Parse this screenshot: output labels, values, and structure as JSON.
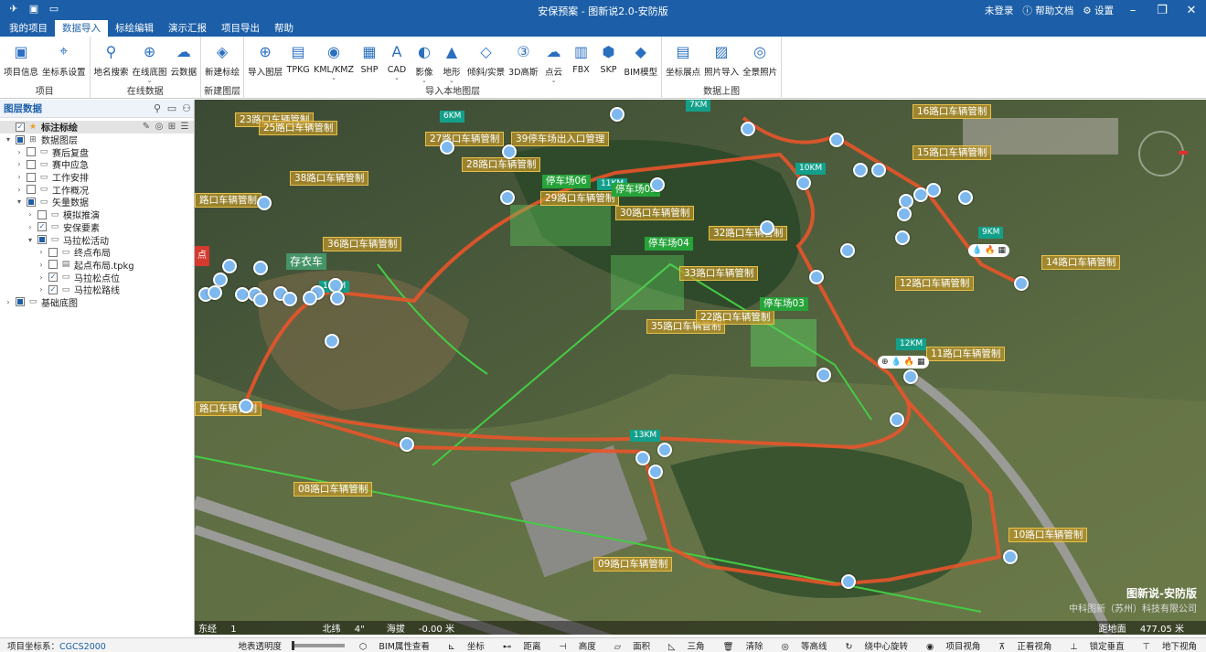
{
  "titlebar": {
    "title": "安保预案 - 图新说2.0-安防版",
    "login": "未登录",
    "help": "帮助文档",
    "settings": "设置"
  },
  "menu": {
    "items": [
      "我的项目",
      "数据导入",
      "标绘编辑",
      "演示汇报",
      "项目导出",
      "帮助"
    ],
    "active": 1
  },
  "ribbon": {
    "groups": [
      {
        "label": "项目",
        "buttons": [
          {
            "label": "项目信息",
            "icon": "project-info-icon",
            "glyph": "▣"
          },
          {
            "label": "坐标系设置",
            "icon": "coordinate-icon",
            "glyph": "⌖"
          }
        ]
      },
      {
        "label": "在线数据",
        "buttons": [
          {
            "label": "地名搜索",
            "icon": "place-search-icon",
            "glyph": "⚲"
          },
          {
            "label": "在线底图",
            "icon": "globe-icon",
            "glyph": "⊕",
            "dd": true
          },
          {
            "label": "云数据",
            "icon": "cloud-icon",
            "glyph": "☁"
          }
        ]
      },
      {
        "label": "新建图层",
        "buttons": [
          {
            "label": "新建标绘",
            "icon": "layers-icon",
            "glyph": "◈"
          }
        ]
      },
      {
        "label": "导入本地图层",
        "buttons": [
          {
            "label": "导入图层",
            "icon": "import-layer-icon",
            "glyph": "⊕"
          },
          {
            "label": "TPKG",
            "icon": "tpkg-icon",
            "glyph": "▤"
          },
          {
            "label": "KML/KMZ",
            "icon": "kml-icon",
            "glyph": "◉",
            "dd": true
          },
          {
            "label": "SHP",
            "icon": "shp-icon",
            "glyph": "▦"
          },
          {
            "label": "CAD",
            "icon": "cad-icon",
            "glyph": "A",
            "dd": true
          },
          {
            "label": "影像",
            "icon": "imagery-icon",
            "glyph": "◐",
            "dd": true
          },
          {
            "label": "地形",
            "icon": "terrain-icon",
            "glyph": "▲",
            "dd": true
          },
          {
            "label": "倾斜/实景",
            "icon": "oblique-icon",
            "glyph": "◇"
          },
          {
            "label": "3D高斯",
            "icon": "gaussian-icon",
            "glyph": "③"
          },
          {
            "label": "点云",
            "icon": "pointcloud-icon",
            "glyph": "☁",
            "dd": true
          },
          {
            "label": "FBX",
            "icon": "fbx-icon",
            "glyph": "▥"
          },
          {
            "label": "SKP",
            "icon": "skp-icon",
            "glyph": "⬢"
          },
          {
            "label": "BIM模型",
            "icon": "bim-icon",
            "glyph": "◆"
          }
        ]
      },
      {
        "label": "数据上图",
        "buttons": [
          {
            "label": "坐标展点",
            "icon": "coord-points-icon",
            "glyph": "▤"
          },
          {
            "label": "照片导入",
            "icon": "photo-icon",
            "glyph": "▨"
          },
          {
            "label": "全景照片",
            "icon": "panorama-icon",
            "glyph": "◎"
          }
        ]
      }
    ]
  },
  "panel": {
    "title": "图层数据",
    "tree": [
      {
        "label": "标注标绘",
        "level": 0,
        "arrow": "",
        "cb": "checked",
        "icon": "★",
        "sel": true
      },
      {
        "label": "数据图层",
        "level": 0,
        "arrow": "▾",
        "cb": "part",
        "icon": "⊞"
      },
      {
        "label": "赛后复盘",
        "level": 1,
        "arrow": "›",
        "cb": "",
        "icon": "▭"
      },
      {
        "label": "赛中应急",
        "level": 1,
        "arrow": "›",
        "cb": "",
        "icon": "▭"
      },
      {
        "label": "工作安排",
        "level": 1,
        "arrow": "›",
        "cb": "",
        "icon": "▭"
      },
      {
        "label": "工作概况",
        "level": 1,
        "arrow": "›",
        "cb": "",
        "icon": "▭"
      },
      {
        "label": "矢量数据",
        "level": 1,
        "arrow": "▾",
        "cb": "part",
        "icon": "▭"
      },
      {
        "label": "模拟推演",
        "level": 2,
        "arrow": "›",
        "cb": "",
        "icon": "▭"
      },
      {
        "label": "安保要素",
        "level": 2,
        "arrow": "›",
        "cb": "checked",
        "icon": "▭"
      },
      {
        "label": "马拉松活动",
        "level": 2,
        "arrow": "▾",
        "cb": "part",
        "icon": "▭"
      },
      {
        "label": "终点布局",
        "level": 3,
        "arrow": "›",
        "cb": "",
        "icon": "▭"
      },
      {
        "label": "起点布局.tpkg",
        "level": 3,
        "arrow": "›",
        "cb": "",
        "icon": "▤"
      },
      {
        "label": "马拉松点位",
        "level": 3,
        "arrow": "›",
        "cb": "checked",
        "icon": "▭"
      },
      {
        "label": "马拉松路线",
        "level": 3,
        "arrow": "›",
        "cb": "checked",
        "icon": "▭"
      },
      {
        "label": "基础底图",
        "level": 0,
        "arrow": "›",
        "cb": "part",
        "icon": "▭"
      }
    ]
  },
  "map": {
    "road_labels": [
      "16路口车辆管制",
      "23路口车辆管制",
      "25路口车辆管制",
      "27路口车辆管制",
      "39停车场出入口管理",
      "28路口车辆管制",
      "38路口车辆管制",
      "15路口车辆管制",
      "29路口车辆管制",
      "30路口车辆管制",
      "路口车辆管制",
      "32路口车辆管制",
      "36路口车辆管制",
      "14路口车辆管制",
      "33路口车辆管制",
      "12路口车辆管制",
      "35路口车辆管制",
      "11路口车辆管制",
      "路口车辆管制",
      "08路口车辆管制",
      "10路口车辆管制",
      "09路口车辆管制",
      "22路口车辆管制"
    ],
    "km_labels": [
      "6KM",
      "7KM",
      "10KM",
      "11KM",
      "9KM",
      "14KM",
      "12KM",
      "13KM"
    ],
    "park_labels": [
      "停车场06",
      "停车场05",
      "停车场04",
      "停车场03"
    ],
    "green_tags": [
      "存衣车"
    ],
    "red_tag": "点",
    "coords": {
      "lon_label": "东经",
      "lon": "1",
      "lat_label": "北纬",
      "lat": "4\"",
      "alt_label": "海拔",
      "alt": "-0.00 米",
      "dist_label": "距地面",
      "dist": "477.05 米"
    },
    "watermark": {
      "line1": "图新说-安防版",
      "line2": "中科图新（苏州）科技有限公司"
    }
  },
  "status": {
    "crs_label": "项目坐标系：",
    "crs": "CGCS2000",
    "transparency": "地表透明度",
    "items": [
      "BIM属性查看",
      "坐标",
      "距离",
      "高度",
      "面积",
      "三角",
      "清除",
      "等高线",
      "绕中心旋转",
      "项目视角",
      "正看视角",
      "锁定垂直",
      "地下视角"
    ]
  }
}
